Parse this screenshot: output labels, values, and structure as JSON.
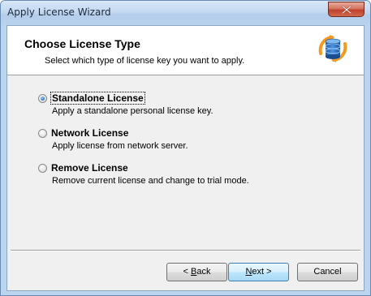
{
  "window": {
    "title": "Apply License Wizard"
  },
  "header": {
    "title": "Choose License Type",
    "subtitle": "Select which type of license key you want to apply.",
    "icon": "license-wizard-icon"
  },
  "options": [
    {
      "label": "Standalone License",
      "description": "Apply a standalone personal license key.",
      "selected": true
    },
    {
      "label": "Network License",
      "description": "Apply license from network server.",
      "selected": false
    },
    {
      "label": "Remove License",
      "description": "Remove current license and change to trial mode.",
      "selected": false
    }
  ],
  "buttons": {
    "back": {
      "prefix": "< ",
      "mnemonic": "B",
      "rest": "ack"
    },
    "next": {
      "mnemonic": "N",
      "rest": "ext >"
    },
    "cancel": {
      "label": "Cancel"
    }
  },
  "colors": {
    "title_bar": "#c2d8f1",
    "close_button": "#c0412b",
    "dialog_background": "#f0f0f0",
    "default_button_border": "#3c7fb1",
    "radio_selected": "#2e6fb8"
  }
}
